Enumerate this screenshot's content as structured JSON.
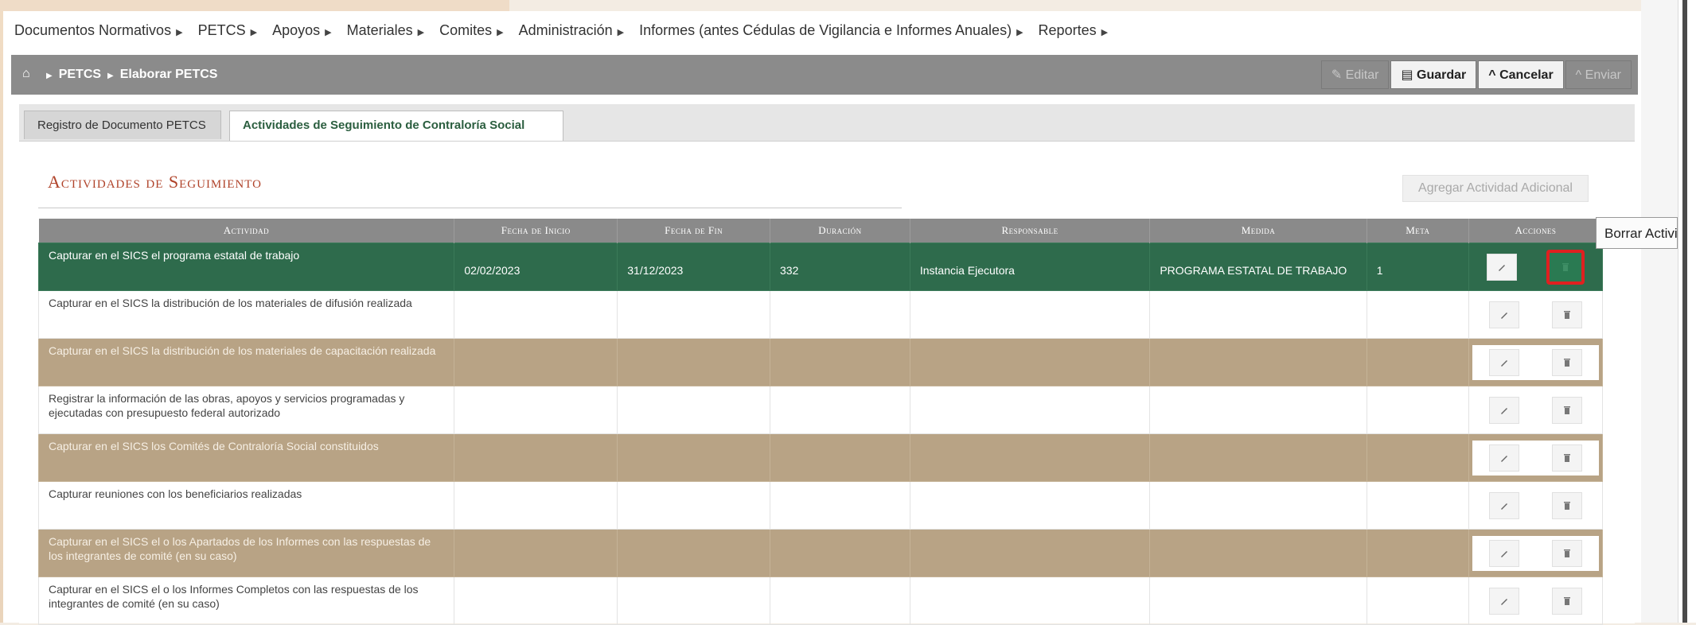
{
  "menu": {
    "items": [
      "Documentos Normativos",
      "PETCS",
      "Apoyos",
      "Materiales",
      "Comites",
      "Administración",
      "Informes (antes Cédulas de Vigilancia e Informes Anuales)",
      "Reportes"
    ]
  },
  "breadcrumb": {
    "items": [
      "PETCS",
      "Elaborar PETCS"
    ]
  },
  "toolbar": {
    "editar": "Editar",
    "guardar": "Guardar",
    "cancelar": "Cancelar",
    "enviar": "Enviar"
  },
  "tabs": [
    {
      "label": "Registro de Documento PETCS",
      "active": false
    },
    {
      "label": "Actividades de Seguimiento de Contraloría Social",
      "active": true
    }
  ],
  "section": {
    "title": "Actividades de Seguimiento",
    "add_button": "Agregar Actividad Adicional"
  },
  "table": {
    "headers": [
      "Actividad",
      "Fecha de Inicio",
      "Fecha de Fin",
      "Duración",
      "Responsable",
      "Medida",
      "Meta",
      "Acciones"
    ],
    "rows": [
      {
        "actividad": "Capturar en el SICS el programa estatal de trabajo",
        "inicio": "02/02/2023",
        "fin": "31/12/2023",
        "duracion": "332",
        "responsable": "Instancia Ejecutora",
        "medida": "PROGRAMA ESTATAL DE TRABAJO",
        "meta": "1"
      },
      {
        "actividad": "Capturar en el SICS la distribución de los materiales de difusión realizada",
        "inicio": "",
        "fin": "",
        "duracion": "",
        "responsable": "",
        "medida": "",
        "meta": ""
      },
      {
        "actividad": "Capturar en el SICS la distribución de los materiales de capacitación realizada",
        "inicio": "",
        "fin": "",
        "duracion": "",
        "responsable": "",
        "medida": "",
        "meta": ""
      },
      {
        "actividad": "Registrar la información de las obras, apoyos y servicios programadas y ejecutadas con presupuesto federal autorizado",
        "inicio": "",
        "fin": "",
        "duracion": "",
        "responsable": "",
        "medida": "",
        "meta": ""
      },
      {
        "actividad": "Capturar en el SICS los Comités de Contraloría Social constituidos",
        "inicio": "",
        "fin": "",
        "duracion": "",
        "responsable": "",
        "medida": "",
        "meta": ""
      },
      {
        "actividad": "Capturar reuniones con los beneficiarios realizadas",
        "inicio": "",
        "fin": "",
        "duracion": "",
        "responsable": "",
        "medida": "",
        "meta": ""
      },
      {
        "actividad": "Capturar en el SICS el o los Apartados de los Informes con las respuestas de los integrantes de comité (en su caso)",
        "inicio": "",
        "fin": "",
        "duracion": "",
        "responsable": "",
        "medida": "",
        "meta": ""
      },
      {
        "actividad": "Capturar en el SICS el o los Informes Completos con las respuestas de los integrantes de comité (en su caso)",
        "inicio": "",
        "fin": "",
        "duracion": "",
        "responsable": "",
        "medida": "",
        "meta": ""
      }
    ]
  },
  "tooltip": "Borrar Actividad",
  "colors": {
    "selected_row": "#2e6b4c",
    "alt_row": "#b8a385",
    "section_title": "#b0432a",
    "highlight_border": "#e02020"
  }
}
